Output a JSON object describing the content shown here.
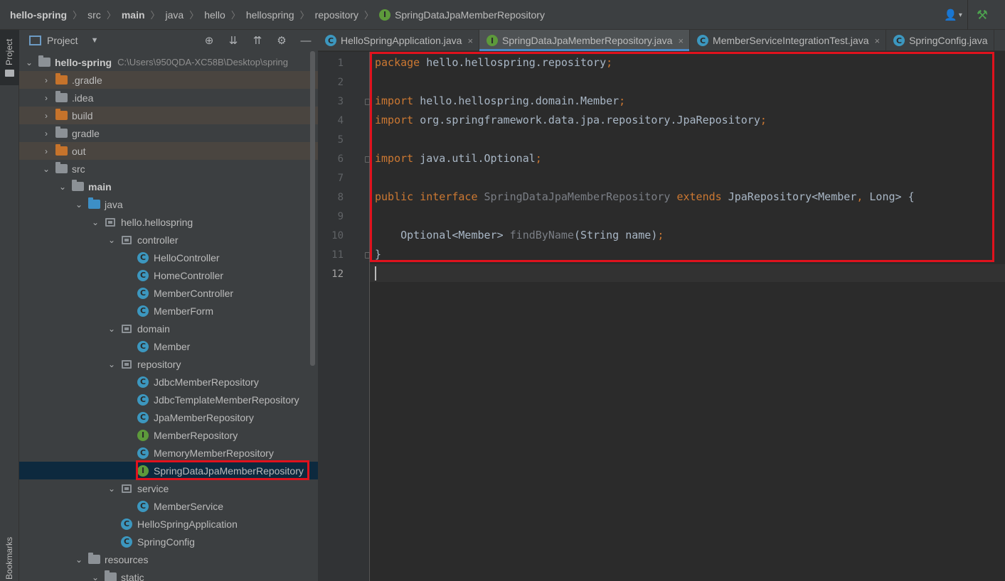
{
  "navbar": {
    "crumbs": [
      "hello-spring",
      "src",
      "main",
      "java",
      "hello",
      "hellospring",
      "repository",
      "SpringDataJpaMemberRepository"
    ],
    "user_icon": "user-icon",
    "build_icon": "hammer-icon"
  },
  "stripe": {
    "project_label": "Project",
    "bookmarks_label": "Bookmarks"
  },
  "project_panel": {
    "title": "Project",
    "root": {
      "name": "hello-spring",
      "path": "C:\\Users\\950QDA-XC58B\\Desktop\\spring"
    },
    "tree": [
      {
        "label": ".gradle"
      },
      {
        "label": ".idea"
      },
      {
        "label": "build"
      },
      {
        "label": "gradle"
      },
      {
        "label": "out"
      },
      {
        "label": "src"
      },
      {
        "label": "main"
      },
      {
        "label": "java"
      },
      {
        "label": "hello.hellospring"
      },
      {
        "label": "controller"
      },
      {
        "label": "HelloController"
      },
      {
        "label": "HomeController"
      },
      {
        "label": "MemberController"
      },
      {
        "label": "MemberForm"
      },
      {
        "label": "domain"
      },
      {
        "label": "Member"
      },
      {
        "label": "repository"
      },
      {
        "label": "JdbcMemberRepository"
      },
      {
        "label": "JdbcTemplateMemberRepository"
      },
      {
        "label": "JpaMemberRepository"
      },
      {
        "label": "MemberRepository"
      },
      {
        "label": "MemoryMemberRepository"
      },
      {
        "label": "SpringDataJpaMemberRepository"
      },
      {
        "label": "service"
      },
      {
        "label": "MemberService"
      },
      {
        "label": "HelloSpringApplication"
      },
      {
        "label": "SpringConfig"
      },
      {
        "label": "resources"
      },
      {
        "label": "static"
      }
    ]
  },
  "tabs": [
    {
      "label": "HelloSpringApplication.java"
    },
    {
      "label": "SpringDataJpaMemberRepository.java"
    },
    {
      "label": "MemberServiceIntegrationTest.java"
    },
    {
      "label": "SpringConfig.java"
    }
  ],
  "editor": {
    "line_numbers": [
      "1",
      "2",
      "3",
      "4",
      "5",
      "6",
      "7",
      "8",
      "9",
      "10",
      "11",
      "12"
    ],
    "code": {
      "l1_kw": "package",
      "l1_rest": " hello.hellospring.repository",
      "l1_end": ";",
      "l3_kw": "import",
      "l3_rest": " hello.hellospring.domain.Member",
      "l3_end": ";",
      "l4_kw": "import",
      "l4_rest": " org.springframework.data.jpa.repository.JpaRepository",
      "l4_end": ";",
      "l6_kw": "import",
      "l6_rest": " java.util.Optional",
      "l6_end": ";",
      "l8_kw1": "public",
      "l8_kw2": "interface",
      "l8_name": "SpringDataJpaMemberRepository",
      "l8_kw3": "extends",
      "l8_type": "JpaRepository<Member",
      "l8_comma": ",",
      "l8_rest": " Long> {",
      "l10_type": "    Optional<Member> ",
      "l10_fn": "findByName",
      "l10_rest": "(String name)",
      "l10_end": ";",
      "l11": "}"
    }
  }
}
